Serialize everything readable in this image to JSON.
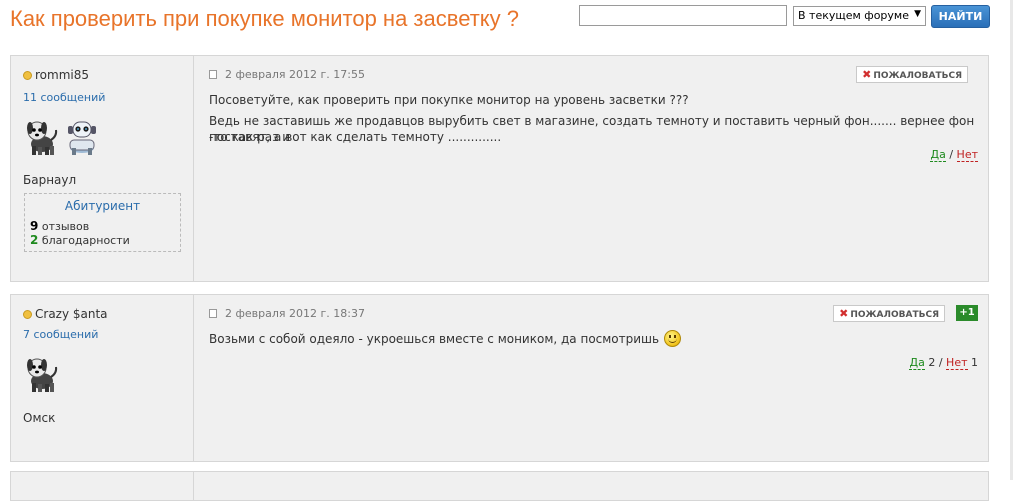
{
  "page": {
    "title": "Как проверить при покупке монитор на засветку ?"
  },
  "search": {
    "value": "",
    "scope": "В текущем форуме",
    "button_label": "НАЙТИ"
  },
  "posts": [
    {
      "author": "rommi85",
      "message_count": "11 сообщений",
      "avatar_icons": [
        "dog-icon",
        "robot-dog-icon"
      ],
      "city": "Барнаул",
      "rank": "Абитуриент",
      "reviews_num": "9",
      "reviews_label": "отзывов",
      "thanks_num": "2",
      "thanks_label": "благодарности",
      "date": "2 февраля 2012 г. 17:55",
      "report_label": "ПОЖАЛОВАТЬСЯ",
      "text_line1": "Посоветуйте, как проверить при покупке монитор на уровень засветки ???",
      "text_line2": "Ведь не заставишь же продавцов вырубить свет в магазине, создать темноту и поставить черный фон....... вернее фон -то как раз и",
      "text_line3": "поставят, а вот как сделать темноту ..............",
      "vote_yes": "Да",
      "vote_sep": "/",
      "vote_no": "Нет"
    },
    {
      "author": "Crazy $anta",
      "message_count": "7 сообщений",
      "avatar_icons": [
        "dog-icon"
      ],
      "city": "Омск",
      "date": "2 февраля 2012 г. 18:37",
      "report_label": "ПОЖАЛОВАТЬСЯ",
      "rating_badge": "+1",
      "text_line1": "Возьми с собой одеяло - укроешься вместе с моником, да посмотришь",
      "smiley_icon": "smiley-icon",
      "vote_yes": "Да",
      "vote_yes_count": "2",
      "vote_sep": "/",
      "vote_no": "Нет",
      "vote_no_count": "1"
    }
  ],
  "colors": {
    "title": "#e8742a",
    "link": "#2a6cab",
    "yes": "#1e8a1e",
    "no": "#c02222",
    "post_bg": "#f0f0f0",
    "search_button": "#2a6fb8"
  }
}
